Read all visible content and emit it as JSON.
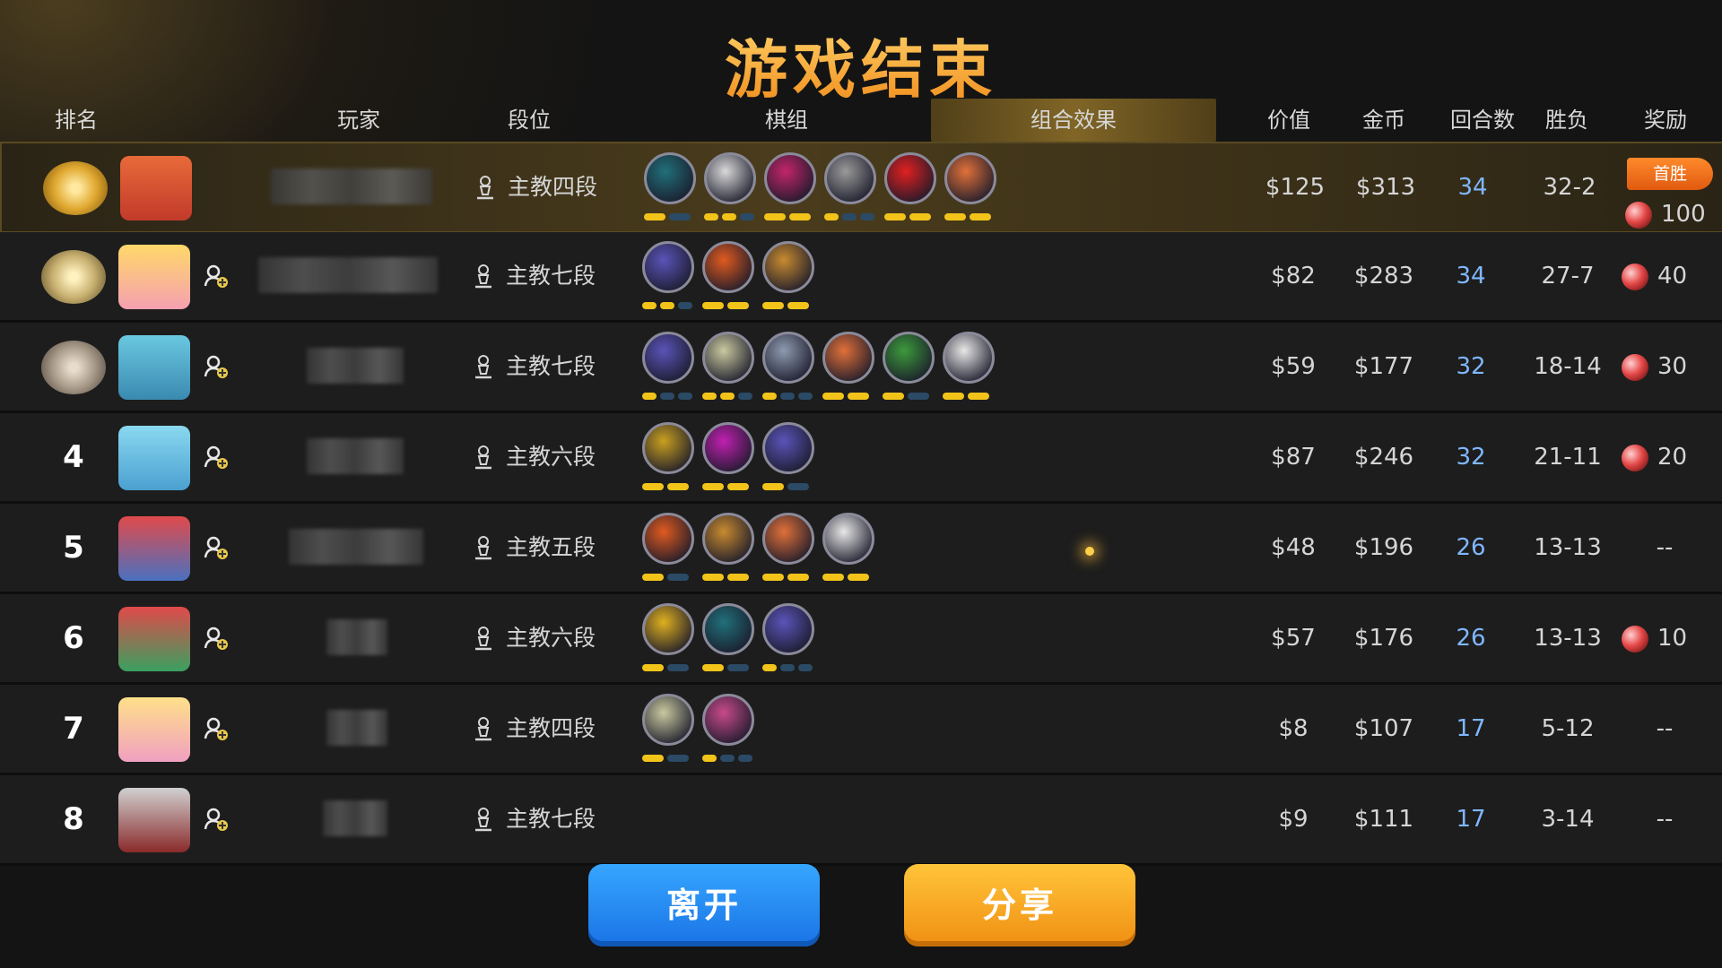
{
  "title": "游戏结束",
  "headers": {
    "rank": "排名",
    "player": "玩家",
    "tier": "段位",
    "lineup": "棋组",
    "synergy": "组合效果",
    "value": "价值",
    "gold": "金币",
    "rounds": "回合数",
    "winloss": "胜负",
    "reward": "奖励"
  },
  "colors": {
    "title": "#f5a623",
    "active_tab": "#8c6e28",
    "bar_on": "#f2c41a",
    "bar_off": "#2b4a66",
    "rounds": "#7fb7ff",
    "leave_button": "#1a73e6",
    "share_button": "#f08f12"
  },
  "rows": [
    {
      "rank": "",
      "medal": "gold",
      "tier": "主教四段",
      "value": "$125",
      "gold": "$313",
      "rounds": "34",
      "winloss": "32-2",
      "reward": "100",
      "flag": "首胜",
      "traits": [
        "#20707a",
        "#d9d9d9",
        "#c2256a",
        "#9a9a9a",
        "#e02020",
        "#e0703a"
      ],
      "bars": [
        [
          1,
          0
        ],
        [
          1,
          1,
          0
        ],
        [
          1,
          1
        ],
        [
          1,
          0,
          0
        ],
        [
          1,
          1
        ],
        [
          1,
          1
        ]
      ]
    },
    {
      "rank": "",
      "medal": "silver",
      "tier": "主教七段",
      "value": "$82",
      "gold": "$283",
      "rounds": "34",
      "winloss": "27-7",
      "reward": "40",
      "traits": [
        "#5a54b8",
        "#e05a20",
        "#c88a30"
      ],
      "bars": [
        [
          1,
          1,
          0
        ],
        [
          1,
          1
        ],
        [
          1,
          1
        ]
      ]
    },
    {
      "rank": "",
      "medal": "bronze",
      "tier": "主教七段",
      "value": "$59",
      "gold": "$177",
      "rounds": "32",
      "winloss": "18-14",
      "reward": "30",
      "traits": [
        "#5a54b8",
        "#c9c9a0",
        "#8e9ab0",
        "#e0703a",
        "#3c9a3c",
        "#e8e8e8"
      ],
      "bars": [
        [
          1,
          0,
          0
        ],
        [
          1,
          1,
          0
        ],
        [
          1,
          0,
          0
        ],
        [
          1,
          1
        ],
        [
          1,
          0
        ],
        [
          1,
          1
        ]
      ]
    },
    {
      "rank": "4",
      "medal": "",
      "tier": "主教六段",
      "value": "$87",
      "gold": "$246",
      "rounds": "32",
      "winloss": "21-11",
      "reward": "20",
      "traits": [
        "#c9a020",
        "#c020b0",
        "#5a54b8"
      ],
      "bars": [
        [
          1,
          1
        ],
        [
          1,
          1
        ],
        [
          1,
          0
        ]
      ]
    },
    {
      "rank": "5",
      "medal": "",
      "tier": "主教五段",
      "value": "$48",
      "gold": "$196",
      "rounds": "26",
      "winloss": "13-13",
      "reward": "--",
      "traits": [
        "#e05a20",
        "#c88a30",
        "#e0703a",
        "#e8e8e8"
      ],
      "bars": [
        [
          1,
          0
        ],
        [
          1,
          1
        ],
        [
          1,
          1
        ],
        [
          1,
          1
        ]
      ]
    },
    {
      "rank": "6",
      "medal": "",
      "tier": "主教六段",
      "value": "$57",
      "gold": "$176",
      "rounds": "26",
      "winloss": "13-13",
      "reward": "10",
      "traits": [
        "#e0b020",
        "#20707a",
        "#5a54b8"
      ],
      "bars": [
        [
          1,
          0
        ],
        [
          1,
          0
        ],
        [
          1,
          0,
          0
        ]
      ]
    },
    {
      "rank": "7",
      "medal": "",
      "tier": "主教四段",
      "value": "$8",
      "gold": "$107",
      "rounds": "17",
      "winloss": "5-12",
      "reward": "--",
      "traits": [
        "#c9c9a0",
        "#c84a8a"
      ],
      "bars": [
        [
          1,
          0
        ],
        [
          1,
          0,
          0
        ]
      ]
    },
    {
      "rank": "8",
      "medal": "",
      "tier": "主教七段",
      "value": "$9",
      "gold": "$111",
      "rounds": "17",
      "winloss": "3-14",
      "reward": "--",
      "traits": [],
      "bars": []
    }
  ],
  "buttons": {
    "leave": "离开",
    "share": "分享"
  }
}
